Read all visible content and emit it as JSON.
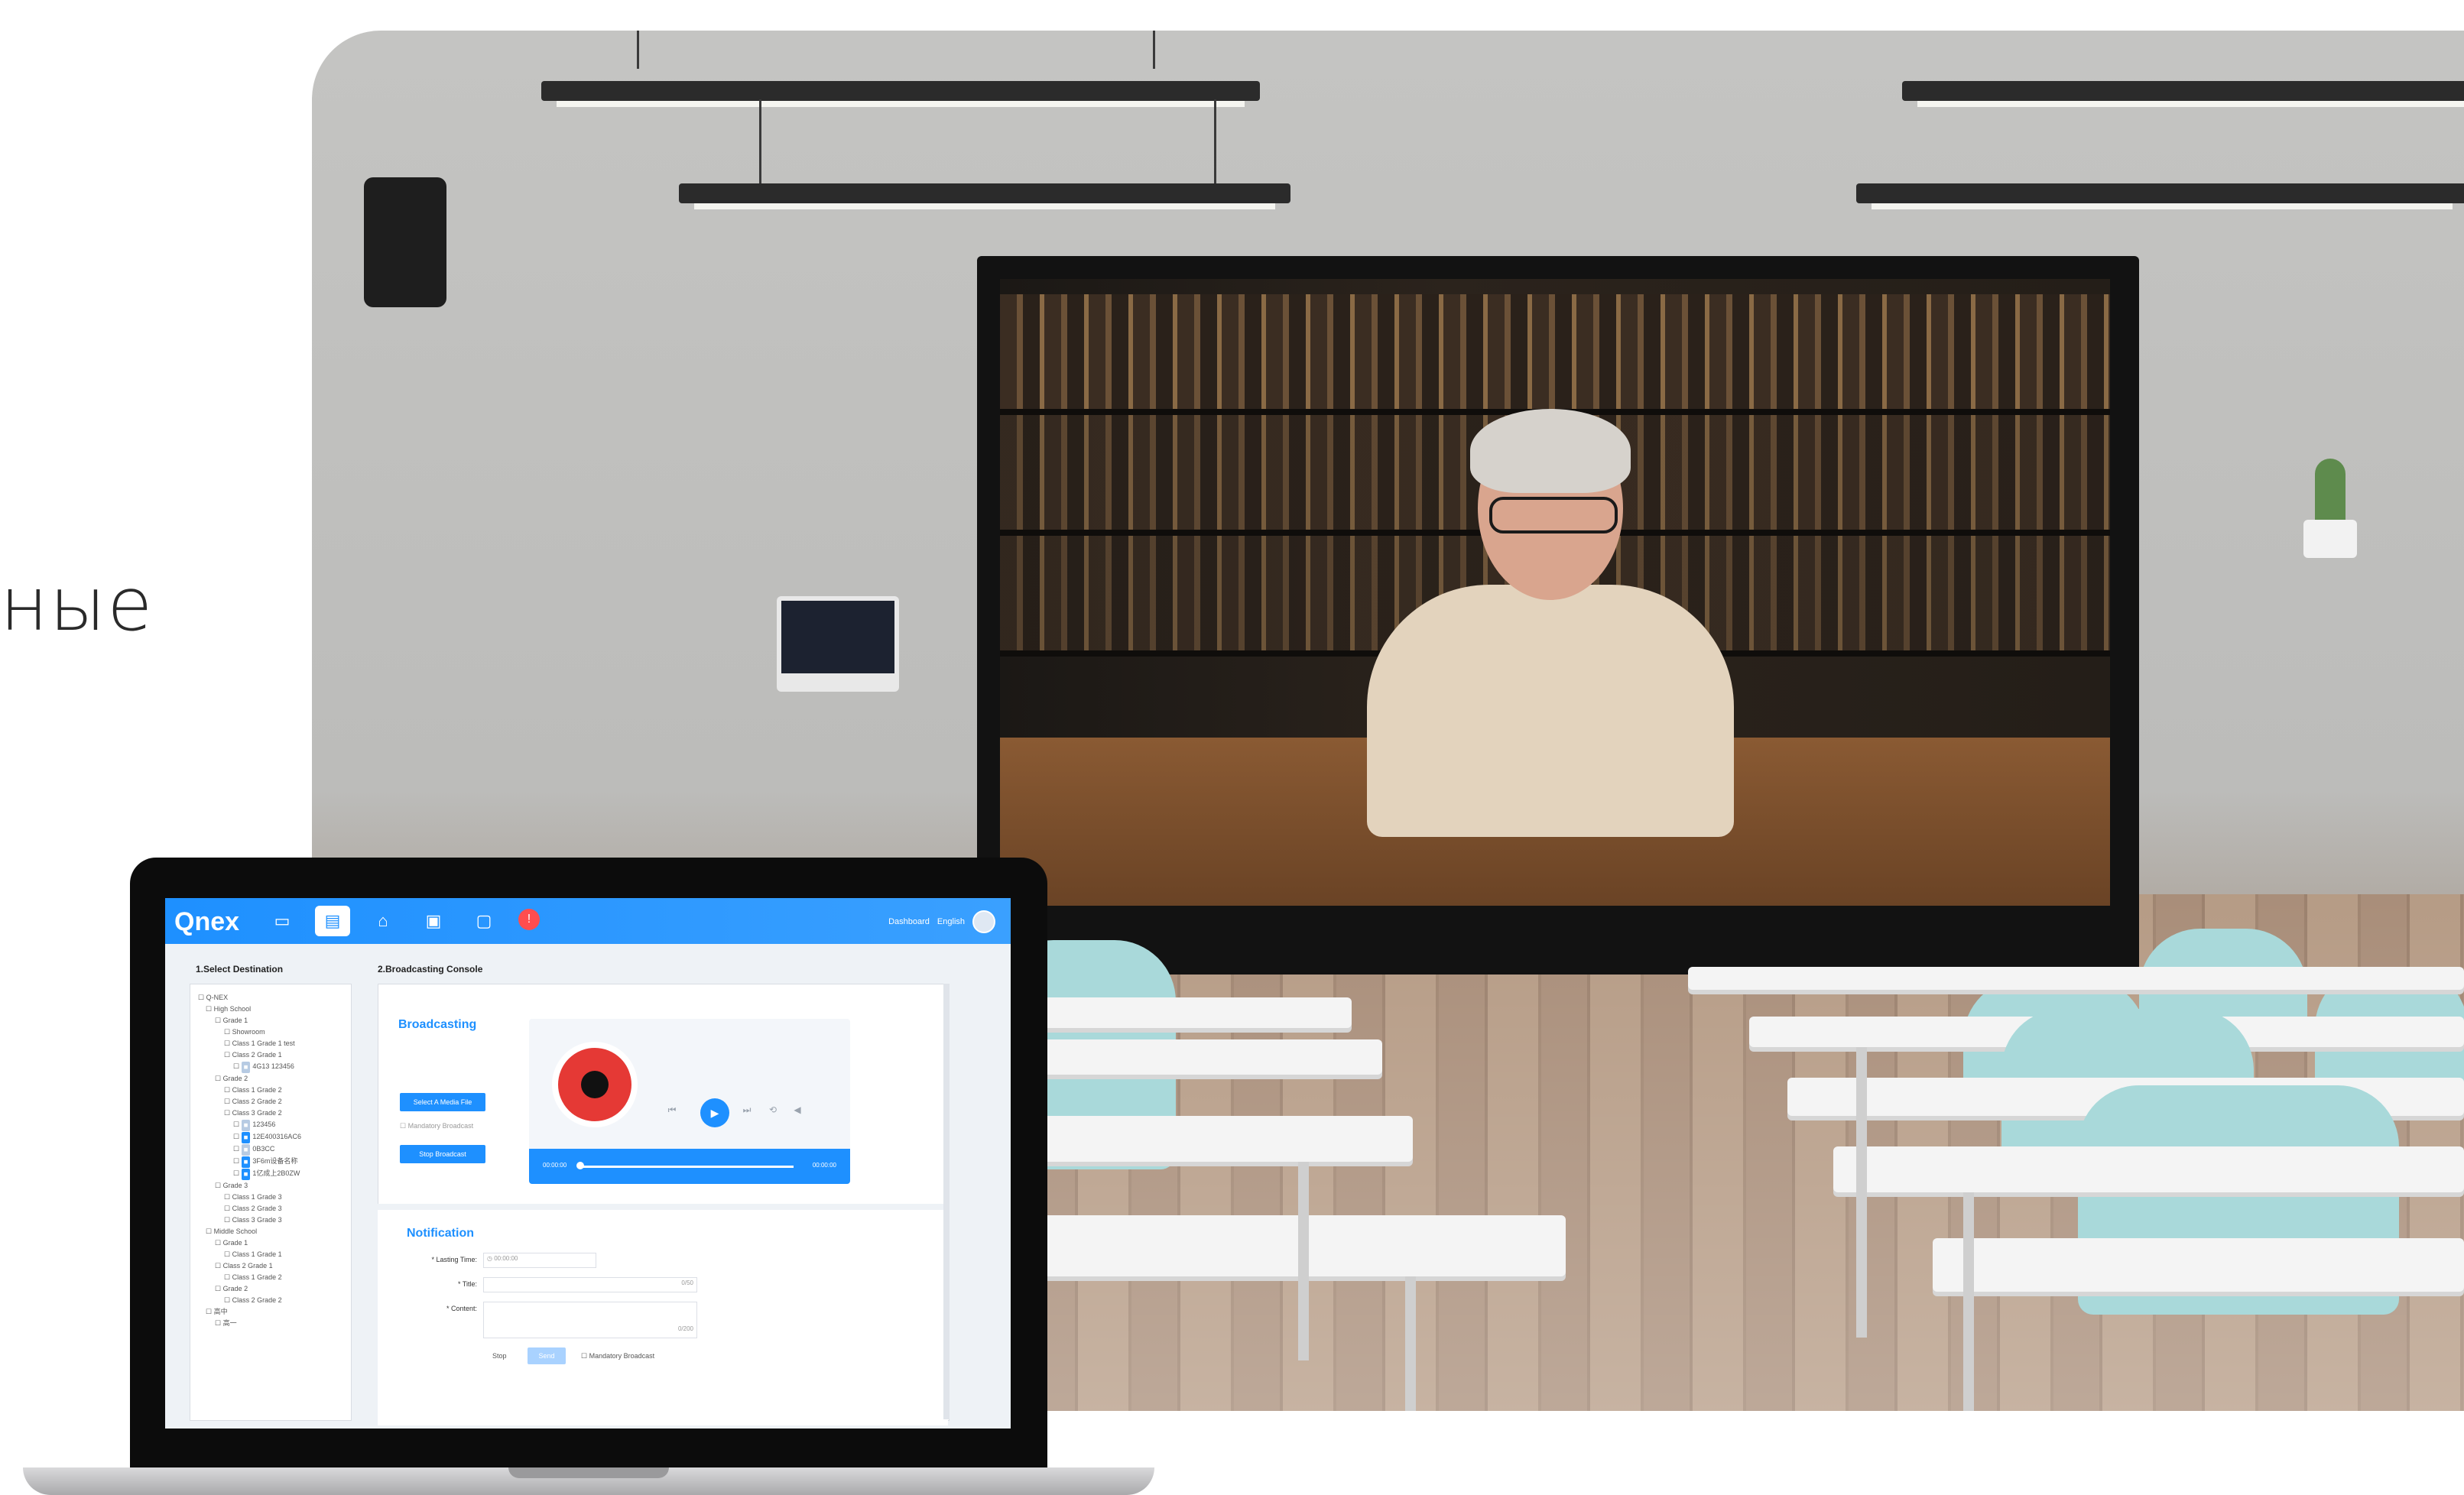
{
  "hero": {
    "text": "ные"
  },
  "app": {
    "logo": "Qnex",
    "nav_right": {
      "dashboard": "Dashboard",
      "language": "English"
    },
    "left": {
      "section_title": "1.Select Destination",
      "tree": [
        {
          "level": 0,
          "label": "Q-NEX"
        },
        {
          "level": 1,
          "label": "High School"
        },
        {
          "level": 2,
          "label": "Grade 1"
        },
        {
          "level": 3,
          "label": "Showroom"
        },
        {
          "level": 3,
          "label": "Class 1 Grade 1 test"
        },
        {
          "level": 3,
          "label": "Class 2 Grade 1"
        },
        {
          "level": 4,
          "label": "4G13 123456",
          "tag": "dim"
        },
        {
          "level": 2,
          "label": "Grade 2"
        },
        {
          "level": 3,
          "label": "Class 1 Grade 2"
        },
        {
          "level": 3,
          "label": "Class 2 Grade 2"
        },
        {
          "level": 3,
          "label": "Class 3 Grade 2"
        },
        {
          "level": 4,
          "label": "123456",
          "tag": "dim"
        },
        {
          "level": 4,
          "label": "12E400316AC6",
          "tag": "blue"
        },
        {
          "level": 4,
          "label": "0B3CC",
          "tag": "dim"
        },
        {
          "level": 4,
          "label": "3F6m设备名称",
          "tag": "blue"
        },
        {
          "level": 4,
          "label": "1亿成上2B0ZW",
          "tag": "blue"
        },
        {
          "level": 2,
          "label": "Grade 3"
        },
        {
          "level": 3,
          "label": "Class 1 Grade 3"
        },
        {
          "level": 3,
          "label": "Class 2 Grade 3"
        },
        {
          "level": 3,
          "label": "Class 3 Grade 3"
        },
        {
          "level": 1,
          "label": "Middle School"
        },
        {
          "level": 2,
          "label": "Grade 1"
        },
        {
          "level": 3,
          "label": "Class 1 Grade 1"
        },
        {
          "level": 2,
          "label": "Class 2 Grade 1"
        },
        {
          "level": 3,
          "label": "Class 1 Grade 2"
        },
        {
          "level": 2,
          "label": "Grade 2"
        },
        {
          "level": 3,
          "label": "Class 2 Grade 2"
        },
        {
          "level": 1,
          "label": "高中"
        },
        {
          "level": 2,
          "label": "高一"
        }
      ]
    },
    "console": {
      "section_title": "2.Broadcasting Console",
      "broadcasting_title": "Broadcasting",
      "select_file_btn": "Select A Media File",
      "mandatory_label": "Mandatory Broadcast",
      "stop_btn": "Stop Broadcast",
      "time_start": "00:00:00",
      "time_end": "00:00:00",
      "progress": 0.0
    },
    "notification": {
      "title": "Notification",
      "lasting_time_label": "* Lasting Time:",
      "lasting_time_value": "00:00:00",
      "title_label": "* Title:",
      "title_counter": "0/50",
      "content_label": "* Content:",
      "content_counter": "0/200",
      "stop_btn": "Stop",
      "send_btn": "Send",
      "mandatory_label": "Mandatory Broadcast"
    },
    "colors": {
      "primary": "#1e90ff",
      "alarm": "#ff4d4f"
    }
  }
}
